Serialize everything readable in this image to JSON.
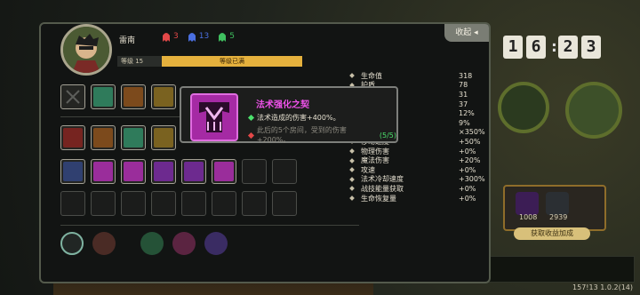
{
  "hud": {
    "clock": [
      "16",
      "23"
    ],
    "panel_values": [
      "1008",
      "2939"
    ],
    "claim_label": "获取收益加成",
    "version": "157!13 1.0.2(14)"
  },
  "character": {
    "name": "雷南",
    "ghosts": [
      {
        "count": "3",
        "color": "#e34848"
      },
      {
        "count": "13",
        "color": "#4a6fe0"
      },
      {
        "count": "5",
        "color": "#3fbf5f"
      }
    ],
    "level_label": "等级 15",
    "level_status": "等级已满"
  },
  "collapse_label": "收起",
  "tooltip": {
    "title": "法术强化之契",
    "line1": "法术造成的伤害+400%。",
    "line2_text": "此后的5个房间，受到的伤害+200%。",
    "line2_count": "(5/5)",
    "accent": "#ef52ea"
  },
  "stats": [
    {
      "key": "生命值",
      "value": "318"
    },
    {
      "key": "护盾",
      "value": "78"
    },
    {
      "key": "攻击力",
      "value": "31"
    },
    {
      "key": "法术强度",
      "value": "37"
    },
    {
      "key": "暴击率",
      "value": "12%"
    },
    {
      "key": "闪避率",
      "value": "9%"
    },
    {
      "key": "暴击伤害",
      "value": "×350%"
    },
    {
      "key": "移动速度",
      "value": "+50%"
    },
    {
      "key": "物理伤害",
      "value": "+0%"
    },
    {
      "key": "魔法伤害",
      "value": "+20%"
    },
    {
      "key": "攻速",
      "value": "+0%"
    },
    {
      "key": "法术冷却速度",
      "value": "+300%"
    },
    {
      "key": "战技能量获取",
      "value": "+0%"
    },
    {
      "key": "生命恢复量",
      "value": "+0%"
    }
  ],
  "icons": {
    "row1": [
      "empty-slot",
      "green-wing",
      "bomb",
      "gold-feather",
      "empty"
    ],
    "row2": [
      "red-slash",
      "orange-gear",
      "green-claws",
      "gold-helm"
    ],
    "row3": [
      "blue-shield",
      "pink-spider",
      "pink-leaf",
      "pink-claw",
      "pink-claw",
      "pink-arrow",
      "empty",
      "empty"
    ]
  }
}
